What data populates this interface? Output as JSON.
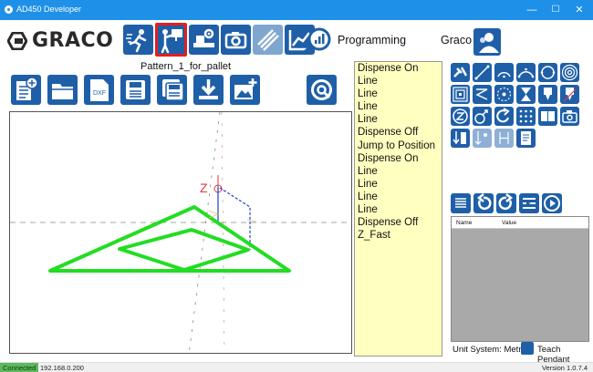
{
  "window": {
    "title": "AD450 Developer",
    "minimize": "—",
    "maximize": "☐",
    "close": "✕",
    "titlebar_color": "#1e90e8"
  },
  "brand": {
    "name": "GRACO"
  },
  "toolbar": {
    "mode_label": "Programming",
    "user_label": "Graco",
    "active_tab": "teach",
    "tabs": [
      "run-icon",
      "teach-icon",
      "settings-icon",
      "camera-icon",
      "maintenance-icon",
      "chart-icon",
      "gauge-icon"
    ]
  },
  "pattern": {
    "name": "Pattern_1_for_pallet"
  },
  "file_toolbar": {
    "dxf_label": "DXF"
  },
  "canvas": {
    "z_label": "Z"
  },
  "program": {
    "steps": [
      "Dispense On",
      "Line",
      "Line",
      "Line",
      "Line",
      "Dispense Off",
      "Jump to Position",
      "Dispense On",
      "Line",
      "Line",
      "Line",
      "Line",
      "Dispense Off",
      "Z_Fast"
    ]
  },
  "params": {
    "name_header": "Name",
    "value_header": "Value"
  },
  "footer": {
    "unit_system": "Unit System: Metric",
    "teach_pendant": "Teach Pendant"
  },
  "status": {
    "connection": "Connected",
    "ip": "192.168.0.200",
    "version": "Version 1.0.7.4"
  },
  "colors": {
    "accent_blue": "#1f5fa8",
    "program_bg": "#ffffc0",
    "path_green": "#22dd22",
    "active_tab_border": "#e02020"
  }
}
